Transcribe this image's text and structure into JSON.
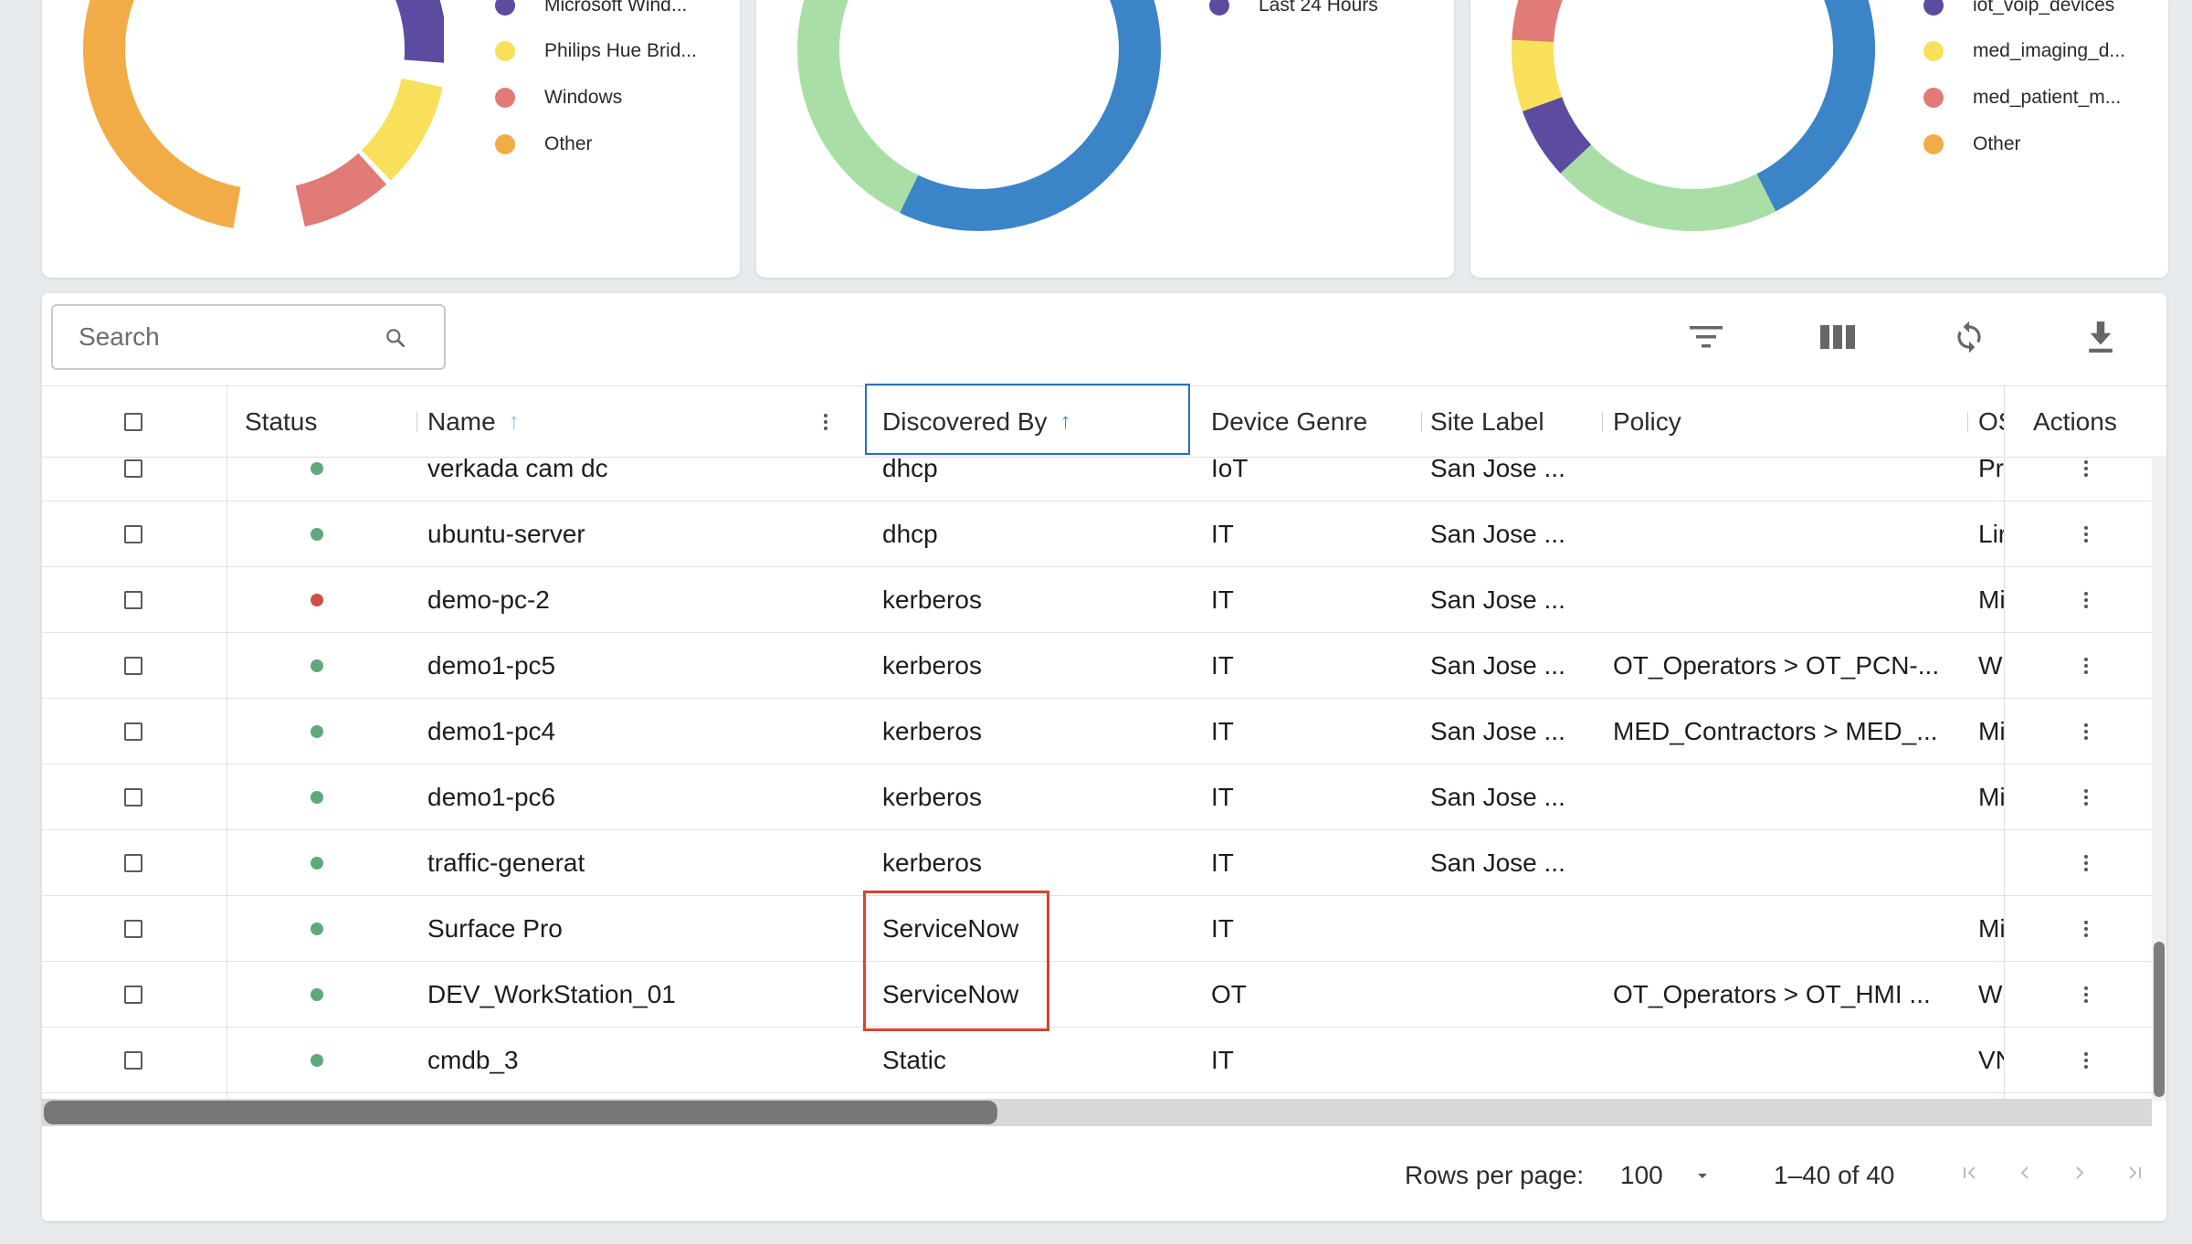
{
  "cards": [
    {
      "legend": [
        {
          "label": "Microsoft Wind...",
          "color": "#5c4ba0"
        },
        {
          "label": "Philips Hue Brid...",
          "color": "#f8e05a"
        },
        {
          "label": "Windows",
          "color": "#e07b78"
        },
        {
          "label": "Other",
          "color": "#f2ac47"
        }
      ]
    },
    {
      "legend": [
        {
          "label": "Last 24 Hours",
          "color": "#5c4ba0"
        }
      ]
    },
    {
      "legend": [
        {
          "label": "iot_voip_devices",
          "color": "#5c4ba0"
        },
        {
          "label": "med_imaging_d...",
          "color": "#f8e05a"
        },
        {
          "label": "med_patient_m...",
          "color": "#e07b78"
        },
        {
          "label": "Other",
          "color": "#f2ac47"
        }
      ]
    }
  ],
  "toolbar": {
    "search_placeholder": "Search"
  },
  "table": {
    "columns": {
      "status": "Status",
      "name": "Name",
      "discovered_by": "Discovered By",
      "device_genre": "Device Genre",
      "site_label": "Site Label",
      "policy": "Policy",
      "os": "OS",
      "actions": "Actions"
    },
    "rows": [
      {
        "status": "online",
        "name": "verkada cam dc",
        "discovered_by": "dhcp",
        "device_genre": "IoT",
        "site_label": "San Jose ...",
        "policy": "",
        "os": "Pr"
      },
      {
        "status": "online",
        "name": "ubuntu-server",
        "discovered_by": "dhcp",
        "device_genre": "IT",
        "site_label": "San Jose ...",
        "policy": "",
        "os": "Lir"
      },
      {
        "status": "offline",
        "name": "demo-pc-2",
        "discovered_by": "kerberos",
        "device_genre": "IT",
        "site_label": "San Jose ...",
        "policy": "",
        "os": "Mi"
      },
      {
        "status": "online",
        "name": "demo1-pc5",
        "discovered_by": "kerberos",
        "device_genre": "IT",
        "site_label": "San Jose ...",
        "policy": "OT_Operators > OT_PCN-...",
        "os": "Wi"
      },
      {
        "status": "online",
        "name": "demo1-pc4",
        "discovered_by": "kerberos",
        "device_genre": "IT",
        "site_label": "San Jose ...",
        "policy": "MED_Contractors > MED_...",
        "os": "Mi"
      },
      {
        "status": "online",
        "name": "demo1-pc6",
        "discovered_by": "kerberos",
        "device_genre": "IT",
        "site_label": "San Jose ...",
        "policy": "",
        "os": "Mi"
      },
      {
        "status": "online",
        "name": "traffic-generat",
        "discovered_by": "kerberos",
        "device_genre": "IT",
        "site_label": "San Jose ...",
        "policy": "",
        "os": ""
      },
      {
        "status": "online",
        "name": "Surface Pro",
        "discovered_by": "ServiceNow",
        "device_genre": "IT",
        "site_label": "",
        "policy": "",
        "os": "Mi"
      },
      {
        "status": "online",
        "name": "DEV_WorkStation_01",
        "discovered_by": "ServiceNow",
        "device_genre": "OT",
        "site_label": "",
        "policy": "OT_Operators > OT_HMI ...",
        "os": "Wi"
      },
      {
        "status": "online",
        "name": "cmdb_3",
        "discovered_by": "Static",
        "device_genre": "IT",
        "site_label": "",
        "policy": "",
        "os": "VN"
      }
    ]
  },
  "colors": {
    "online": "#5ea87a",
    "offline": "#cf4f45",
    "accent": "#3d8ee0",
    "highlight": "#d9432f"
  },
  "pagination": {
    "rows_per_page_label": "Rows per page:",
    "rows_per_page_value": "100",
    "range_text": "1–40 of 40"
  }
}
